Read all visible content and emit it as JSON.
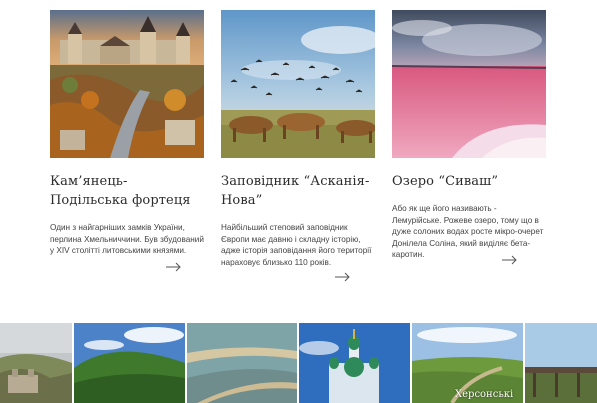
{
  "cards": [
    {
      "title": "Кам’янець-Подільська фортеця",
      "text": "Один з найгарніших замків України, перлина Хмельниччини. Був збудований у XIV столітті литовськими князями.",
      "image_icon": "castle-photo",
      "arrow_icon": "arrow-right-icon"
    },
    {
      "title": "Заповідник “Асканія-Нова”",
      "text": "Найбільший степовий заповідник Європи має давню і складну історію, адже історія заповідання його території нараховує близько 110 років.",
      "image_icon": "horses-birds-photo",
      "arrow_icon": "arrow-right-icon"
    },
    {
      "title": "Озеро “Сиваш”",
      "text": "Або як ще його називають - Лемурійське. Рожеве озеро, тому що в дуже солоних водах росте мікро-очерет Донілела Соліна, який виділяє бета-каротин.",
      "image_icon": "pink-lake-photo",
      "arrow_icon": "arrow-right-icon"
    }
  ],
  "gallery": {
    "caption": "Херсонські",
    "tiles": [
      "coastal-fortress-photo",
      "forest-hills-photo",
      "sand-spit-photo",
      "baroque-church-photo",
      "river-valley-photo",
      "bridge-photo"
    ]
  },
  "colors": {
    "text": "#333333",
    "title": "#2b2b2b",
    "arrow": "#555555"
  }
}
